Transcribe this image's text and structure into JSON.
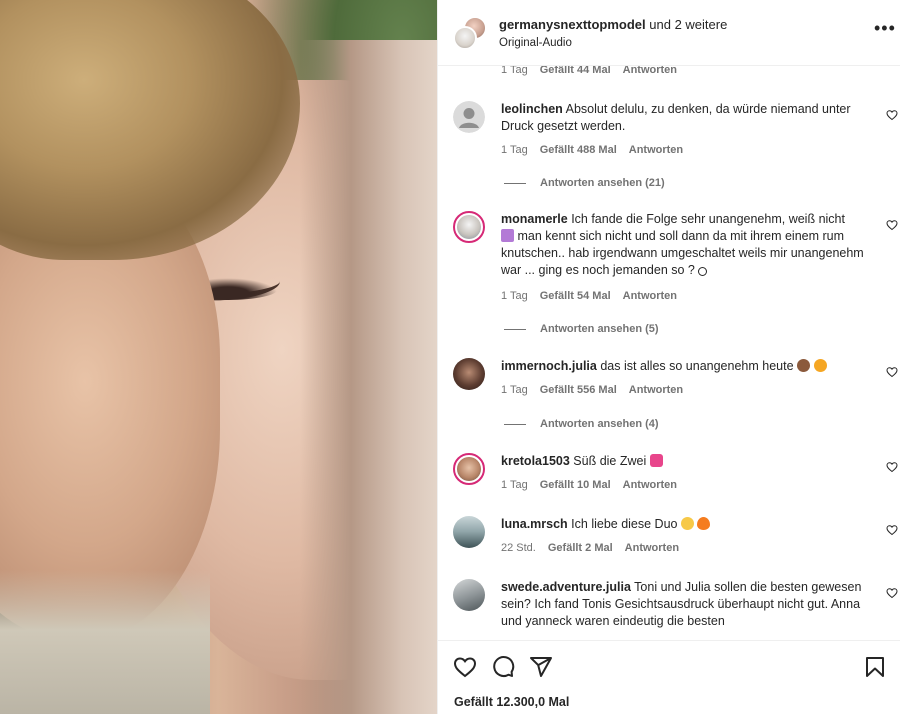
{
  "header": {
    "owner": "germanysnexttopmodel",
    "owner_suffix": " und 2 weitere",
    "audio": "Original-Audio",
    "more": "•••"
  },
  "first_meta": {
    "time": "1 Tag",
    "likes": "Gefällt 44 Mal",
    "reply": "Antworten"
  },
  "comments": [
    {
      "user": "leolinchen",
      "text": "Absolut delulu, zu denken, da würde niemand unter Druck gesetzt werden.",
      "time": "1 Tag",
      "likes": "Gefällt 488 Mal",
      "reply": "Antworten",
      "view_replies": "Antworten ansehen (21)"
    },
    {
      "user": "monamerle",
      "text": "Ich fande die Folge sehr unangenehm, weiß nicht",
      "text_line2": "man kennt sich nicht und soll dann da mit ihrem einem rum knutschen.. hab irgendwann umgeschaltet weils mir unangenehm war ... ging es noch jemanden so ?",
      "time": "1 Tag",
      "likes": "Gefällt 54 Mal",
      "reply": "Antworten",
      "view_replies": "Antworten ansehen (5)"
    },
    {
      "user": "immernoch.julia",
      "text": "das ist alles so unangenehm heute",
      "time": "1 Tag",
      "likes": "Gefällt 556 Mal",
      "reply": "Antworten",
      "view_replies": "Antworten ansehen (4)"
    },
    {
      "user": "kretola1503",
      "text": "Süß die Zwei",
      "time": "1 Tag",
      "likes": "Gefällt 10 Mal",
      "reply": "Antworten"
    },
    {
      "user": "luna.mrsch",
      "text": "Ich liebe diese Duo",
      "time": "22 Std.",
      "likes": "Gefällt 2 Mal",
      "reply": "Antworten"
    },
    {
      "user": "swede.adventure.julia",
      "text": "Toni und Julia sollen die besten gewesen sein? Ich fand Tonis Gesichtsausdruck überhaupt nicht gut. Anna und yanneck waren eindeutig die besten"
    }
  ],
  "footer": {
    "likes": "Gefällt 12.300,0 Mal"
  },
  "icons": {
    "like": "heart-icon",
    "comment": "comment-icon",
    "share": "paper-plane-icon",
    "save": "bookmark-icon",
    "more": "more-dots-icon"
  },
  "colors": {
    "text": "#262626",
    "muted": "#737373",
    "story_ring": "#d62976",
    "divider": "#efefef"
  }
}
